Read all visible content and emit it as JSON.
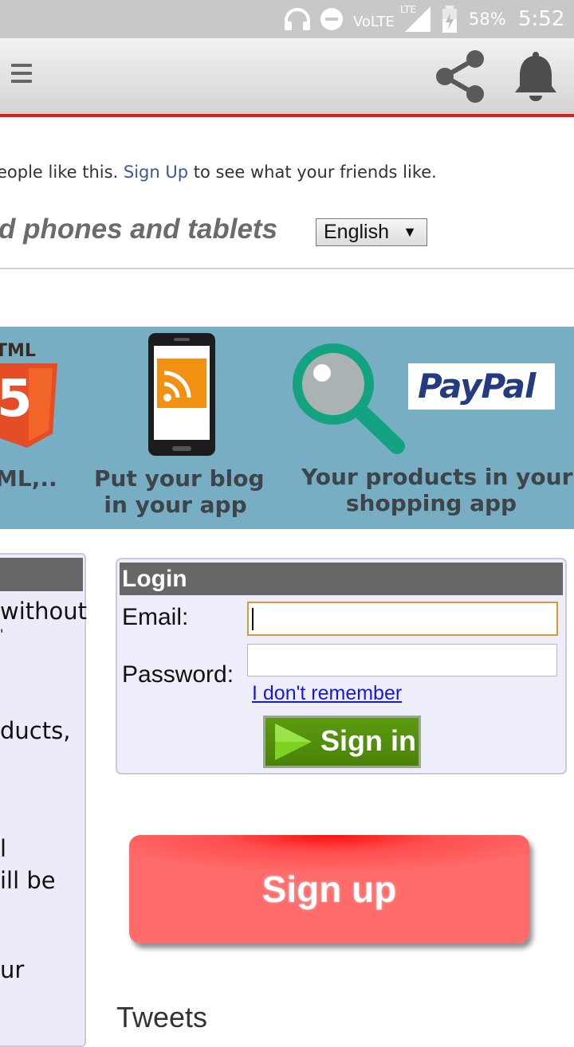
{
  "status_bar": {
    "network": "VoLTE",
    "network_badge": "LTE",
    "battery": "58%",
    "time": "5:52",
    "icons": [
      "headphones-icon",
      "do-not-disturb-icon",
      "signal-icon",
      "battery-charging-icon"
    ]
  },
  "toolbar": {
    "icons": [
      "menu-icon",
      "share-icon",
      "bell-icon"
    ],
    "accent_line": "#e21b1b"
  },
  "social": {
    "prefix": "eople like this.",
    "link": "Sign Up",
    "suffix": "to see what your friends like."
  },
  "headline": "d phones and tablets",
  "language": {
    "selected": "English",
    "arrow": "▼"
  },
  "banner": {
    "html_label": "TML",
    "html_digit": "5",
    "caption_1": "ML,..",
    "caption_2_line1": "Put your blog",
    "caption_2_line2": "in your app",
    "caption_3_line1": "Your products in your",
    "caption_3_line2": "shopping app",
    "paypal": "PayPal",
    "colors": {
      "background": "#77aec4",
      "html5": "#e44d26",
      "rss": "#f29111",
      "magnifier": "#13a381"
    }
  },
  "left_panel": {
    "lines": [
      "without",
      "'",
      "ducts,",
      "l",
      "ill be",
      "ur"
    ]
  },
  "login": {
    "title": "Login",
    "email_label": "Email:",
    "email_value": "",
    "password_label": "Password:",
    "password_value": "",
    "forgot_link": "I don't remember",
    "signin_label": "Sign in"
  },
  "signup": {
    "label": "Sign up"
  },
  "tweets": {
    "label": "Tweets"
  }
}
